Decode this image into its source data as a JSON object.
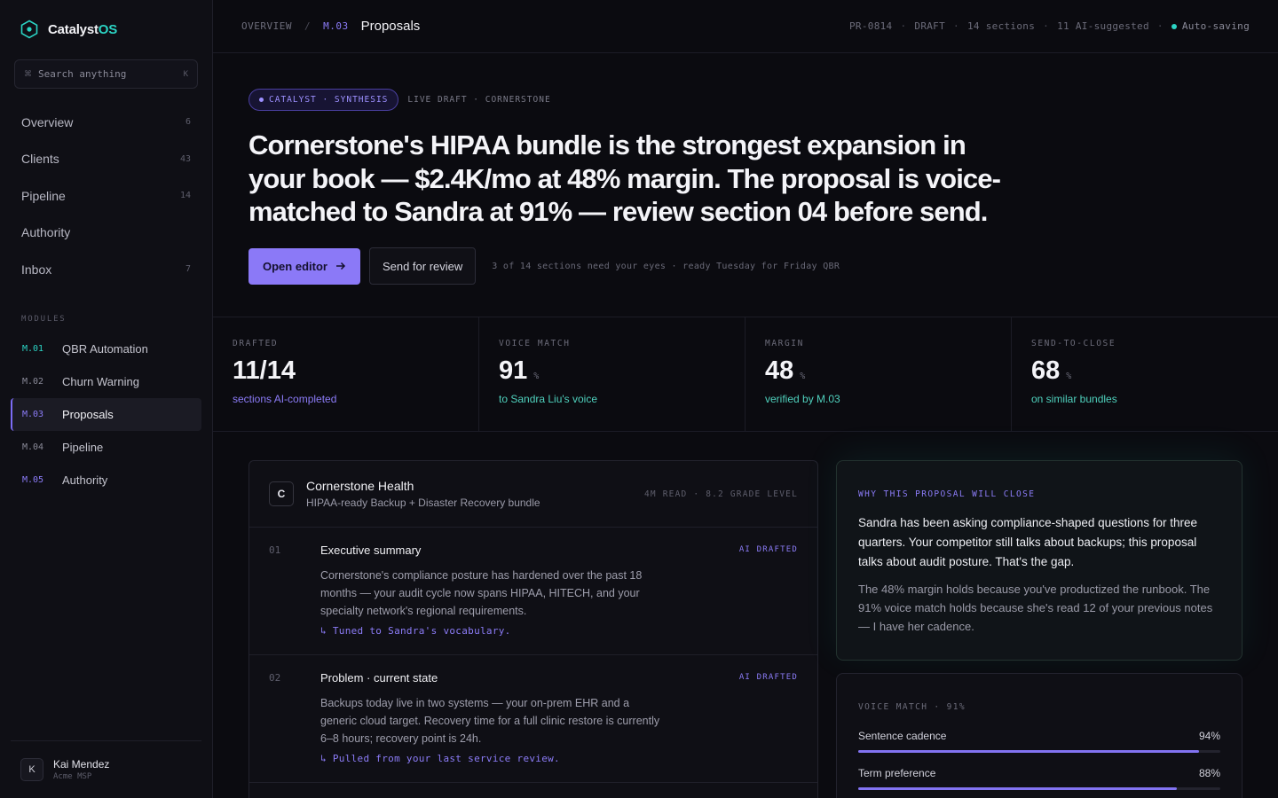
{
  "app": {
    "name_main": "Catalyst",
    "name_accent": "OS"
  },
  "search": {
    "placeholder": "Search anything",
    "shortcut_symbol": "⌘",
    "shortcut_key": "K"
  },
  "nav": [
    {
      "label": "Overview",
      "count": "6"
    },
    {
      "label": "Clients",
      "count": "43"
    },
    {
      "label": "Pipeline",
      "count": "14"
    },
    {
      "label": "Authority",
      "count": ""
    },
    {
      "label": "Inbox",
      "count": "7"
    }
  ],
  "modules": {
    "label": "MODULES",
    "items": [
      {
        "code": "M.01",
        "label": "QBR Automation",
        "code_color": "#2bd4c4"
      },
      {
        "code": "M.02",
        "label": "Churn Warning",
        "code_color": "#8a8a98"
      },
      {
        "code": "M.03",
        "label": "Proposals",
        "code_color": "#8c7cf8",
        "active": true
      },
      {
        "code": "M.04",
        "label": "Pipeline",
        "code_color": "#8a8a98"
      },
      {
        "code": "M.05",
        "label": "Authority",
        "code_color": "#8c7cf8"
      }
    ]
  },
  "user": {
    "initial": "K",
    "name": "Kai Mendez",
    "org": "Acme MSP"
  },
  "breadcrumb": {
    "root": "OVERVIEW",
    "sep": "/",
    "code": "M.03",
    "current": "Proposals"
  },
  "meta": {
    "id": "PR-0814",
    "status": "DRAFT",
    "sections": "14 sections",
    "ai": "11 AI-suggested",
    "autosave": "Auto-saving"
  },
  "hero": {
    "tag": "CATALYST · SYNTHESIS",
    "tag_after": "LIVE DRAFT · CORNERSTONE",
    "headline": "Cornerstone's HIPAA bundle is the strongest expansion in your book — $2.4K/mo at 48% margin. The proposal is voice-matched to Sandra at 91% — review section 04 before send.",
    "primary": "Open editor",
    "secondary": "Send for review",
    "note": "3 of 14 sections need your eyes · ready Tuesday for Friday QBR"
  },
  "stats": [
    {
      "label": "DRAFTED",
      "value": "11/14",
      "unit": "",
      "sub": "sections AI-completed",
      "tone": "violet"
    },
    {
      "label": "VOICE MATCH",
      "value": "91",
      "unit": "%",
      "sub": "to Sandra Liu's voice",
      "tone": "teal"
    },
    {
      "label": "MARGIN",
      "value": "48",
      "unit": "%",
      "sub": "verified by M.03",
      "tone": "teal"
    },
    {
      "label": "SEND-TO-CLOSE",
      "value": "68",
      "unit": "%",
      "sub": "on similar bundles",
      "tone": "teal"
    }
  ],
  "doc": {
    "mark": "C",
    "client": "Cornerstone Health",
    "bundle": "HIPAA-ready Backup + Disaster Recovery bundle",
    "read": "4M READ · 8.2 GRADE LEVEL",
    "sections": [
      {
        "num": "01",
        "title": "Executive summary",
        "badge": "AI DRAFTED",
        "body": "Cornerstone's compliance posture has hardened over the past 18 months — your audit cycle now spans HIPAA, HITECH, and your specialty network's regional requirements.",
        "note": "↳ Tuned to Sandra's vocabulary."
      },
      {
        "num": "02",
        "title": "Problem · current state",
        "badge": "AI DRAFTED",
        "body": "Backups today live in two systems — your on-prem EHR and a generic cloud target. Recovery time for a full clinic restore is currently 6–8 hours; recovery point is 24h.",
        "note": "↳ Pulled from your last service review."
      }
    ]
  },
  "why": {
    "label": "WHY THIS PROPOSAL WILL CLOSE",
    "lead": "Sandra has been asking compliance-shaped questions for three quarters. Your competitor still talks about backups; this proposal talks about audit posture. That's the gap.",
    "rest": "The 48% margin holds because you've productized the runbook. The 91% voice match holds because she's read 12 of your previous notes — I have her cadence."
  },
  "voice": {
    "label": "VOICE MATCH · 91%",
    "metrics": [
      {
        "name": "Sentence cadence",
        "value": "94%",
        "fraction": 0.94
      },
      {
        "name": "Term preference",
        "value": "88%",
        "fraction": 0.88
      }
    ]
  }
}
